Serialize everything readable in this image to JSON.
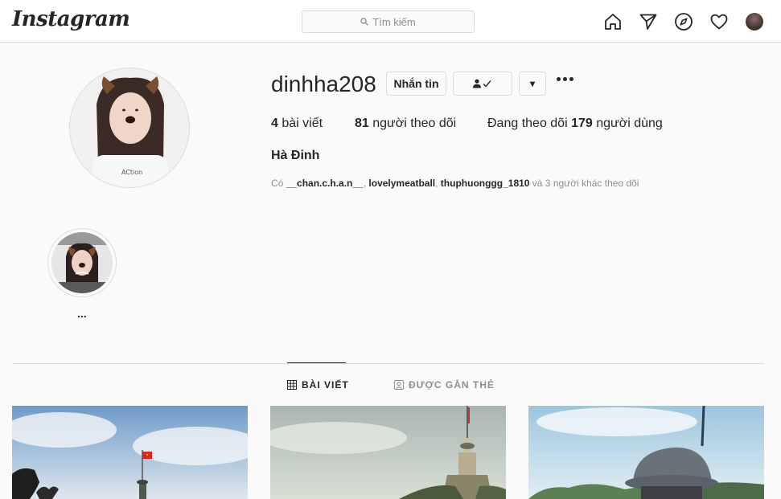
{
  "navbar": {
    "logo": "Instagram",
    "search_placeholder": "Tìm kiếm",
    "icons": [
      "home-icon",
      "direct-icon",
      "explore-icon",
      "activity-icon",
      "profile-avatar"
    ]
  },
  "profile": {
    "username": "dinhha208",
    "message_button": "Nhắn tin",
    "dropdown_glyph": "▾",
    "stats": {
      "posts_count": "4",
      "posts_label": " bài viết",
      "followers_count": "81",
      "followers_label": " người theo dõi",
      "following_prefix": "Đang theo dõi ",
      "following_count": "179",
      "following_label": " người dùng"
    },
    "full_name": "Hà Đinh",
    "followed_by": {
      "prefix": "Có ",
      "user1": "__chan.c.h.a.n__",
      "sep1": ", ",
      "user2": "lovelymeatball",
      "sep2": ", ",
      "user3": "thuphuonggg_1810",
      "suffix": " và 3 người khác theo dõi"
    }
  },
  "highlights": [
    {
      "label": "..."
    }
  ],
  "tabs": {
    "posts": "BÀI VIẾT",
    "tagged": "ĐƯỢC GẮN THẺ"
  },
  "colors": {
    "text": "#262626",
    "secondary": "#8e8e8e",
    "border": "#dbdbdb",
    "background": "#fafafa",
    "flag_red": "#da251d"
  }
}
